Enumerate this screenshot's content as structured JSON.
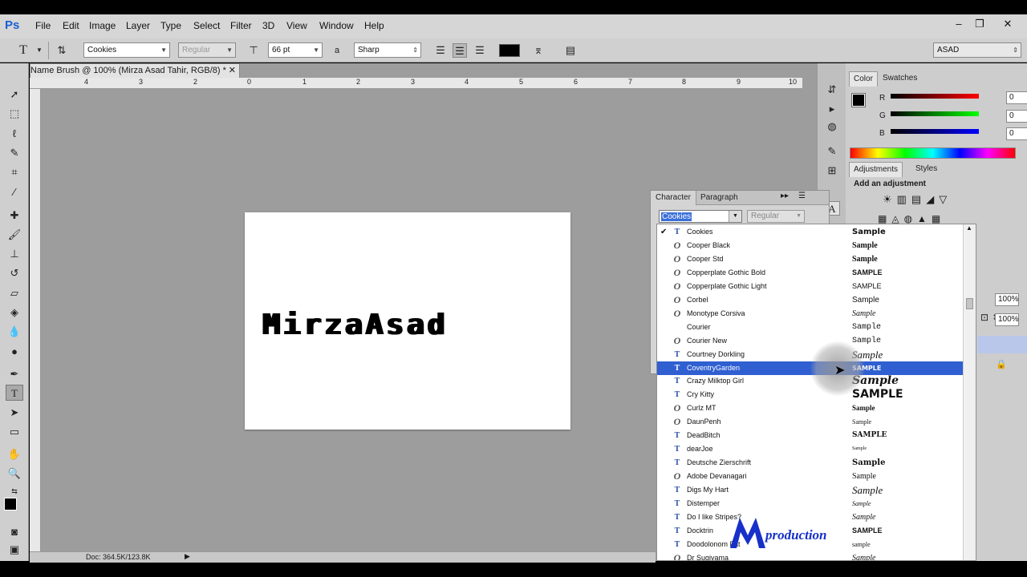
{
  "app": {
    "logo": "Ps",
    "menu": [
      "File",
      "Edit",
      "Image",
      "Layer",
      "Type",
      "Select",
      "Filter",
      "3D",
      "View",
      "Window",
      "Help"
    ],
    "window_controls": [
      "–",
      "❐",
      "✕"
    ]
  },
  "options_bar": {
    "tool_glyph": "T",
    "font_family": "Cookies",
    "font_style": "Regular",
    "font_size": "66 pt",
    "aa_glyph": "a",
    "antialias": "Sharp",
    "workspace": "ASAD",
    "text_color": "#000000"
  },
  "document": {
    "tab_title": "Name Brush @ 100% (Mirza Asad Tahir, RGB/8) *",
    "tab_close": "✕",
    "ruler_labels": [
      "4",
      "3",
      "2",
      "1",
      "0",
      "1",
      "2",
      "3",
      "4",
      "5",
      "6",
      "7",
      "8",
      "9",
      "10"
    ],
    "canvas_text": "MirzaAsad",
    "status": "Doc: 364.5K/123.8K"
  },
  "color_panel": {
    "tabs": [
      "Color",
      "Swatches"
    ],
    "channels": [
      {
        "label": "R",
        "value": "0"
      },
      {
        "label": "G",
        "value": "0"
      },
      {
        "label": "B",
        "value": "0"
      }
    ]
  },
  "adjustments_panel": {
    "tabs": [
      "Adjustments",
      "Styles"
    ],
    "heading": "Add an adjustment",
    "layers_opacity": "100%",
    "layers_fill": "100%"
  },
  "character_panel": {
    "tabs": [
      "Character",
      "Paragraph"
    ],
    "font_value": "Cookies",
    "style_value": "Regular"
  },
  "font_list": [
    {
      "name": "Cookies",
      "sample": "Sample",
      "type": "tt",
      "checked": true,
      "selected": false
    },
    {
      "name": "Cooper Black",
      "sample": "Sample",
      "type": "ot",
      "checked": false,
      "selected": false
    },
    {
      "name": "Cooper Std",
      "sample": "Sample",
      "type": "ot",
      "checked": false,
      "selected": false
    },
    {
      "name": "Copperplate Gothic Bold",
      "sample": "SAMPLE",
      "type": "ot",
      "checked": false,
      "selected": false
    },
    {
      "name": "Copperplate Gothic Light",
      "sample": "SAMPLE",
      "type": "ot",
      "checked": false,
      "selected": false
    },
    {
      "name": "Corbel",
      "sample": "Sample",
      "type": "ot",
      "checked": false,
      "selected": false
    },
    {
      "name": "Monotype Corsiva",
      "sample": "Sample",
      "type": "ot",
      "checked": false,
      "selected": false
    },
    {
      "name": "Courier",
      "sample": "Sample",
      "type": "none",
      "checked": false,
      "selected": false
    },
    {
      "name": "Courier New",
      "sample": "Sample",
      "type": "ot",
      "checked": false,
      "selected": false
    },
    {
      "name": "Courtney Dorkling",
      "sample": "Sample",
      "type": "tt",
      "checked": false,
      "selected": false
    },
    {
      "name": "CoventryGarden",
      "sample": "SAMPLE",
      "type": "tt",
      "checked": false,
      "selected": true
    },
    {
      "name": "Crazy Milktop Girl",
      "sample": "Sample",
      "type": "tt",
      "checked": false,
      "selected": false
    },
    {
      "name": "Cry Kitty",
      "sample": "SAMPLE",
      "type": "tt",
      "checked": false,
      "selected": false
    },
    {
      "name": "Curlz MT",
      "sample": "Sample",
      "type": "ot",
      "checked": false,
      "selected": false
    },
    {
      "name": "DaunPenh",
      "sample": "Sample",
      "type": "ot",
      "checked": false,
      "selected": false
    },
    {
      "name": "DeadBitch",
      "sample": "SAMPLE",
      "type": "tt",
      "checked": false,
      "selected": false
    },
    {
      "name": "dearJoe",
      "sample": "Sample",
      "type": "tt",
      "checked": false,
      "selected": false
    },
    {
      "name": "Deutsche Zierschrift",
      "sample": "Sample",
      "type": "tt",
      "checked": false,
      "selected": false
    },
    {
      "name": "Adobe Devanagari",
      "sample": "Sample",
      "type": "ot",
      "checked": false,
      "selected": false
    },
    {
      "name": "Digs My Hart",
      "sample": "Sample",
      "type": "tt",
      "checked": false,
      "selected": false
    },
    {
      "name": "Distemper",
      "sample": "Sample",
      "type": "tt",
      "checked": false,
      "selected": false
    },
    {
      "name": "Do I like Stripes?",
      "sample": "Sample",
      "type": "tt",
      "checked": false,
      "selected": false
    },
    {
      "name": "Docktrin",
      "sample": "SAMPLE",
      "type": "tt",
      "checked": false,
      "selected": false
    },
    {
      "name": "Doodolonom Fat",
      "sample": "sample",
      "type": "tt",
      "checked": false,
      "selected": false
    },
    {
      "name": "Dr Sugiyama",
      "sample": "Sample",
      "type": "ot",
      "checked": false,
      "selected": false
    }
  ],
  "watermark": "production",
  "colors": {
    "accent": "#2f5fd1",
    "workspace_gray": "#9d9d9d",
    "watermark_blue": "#1730c9"
  }
}
